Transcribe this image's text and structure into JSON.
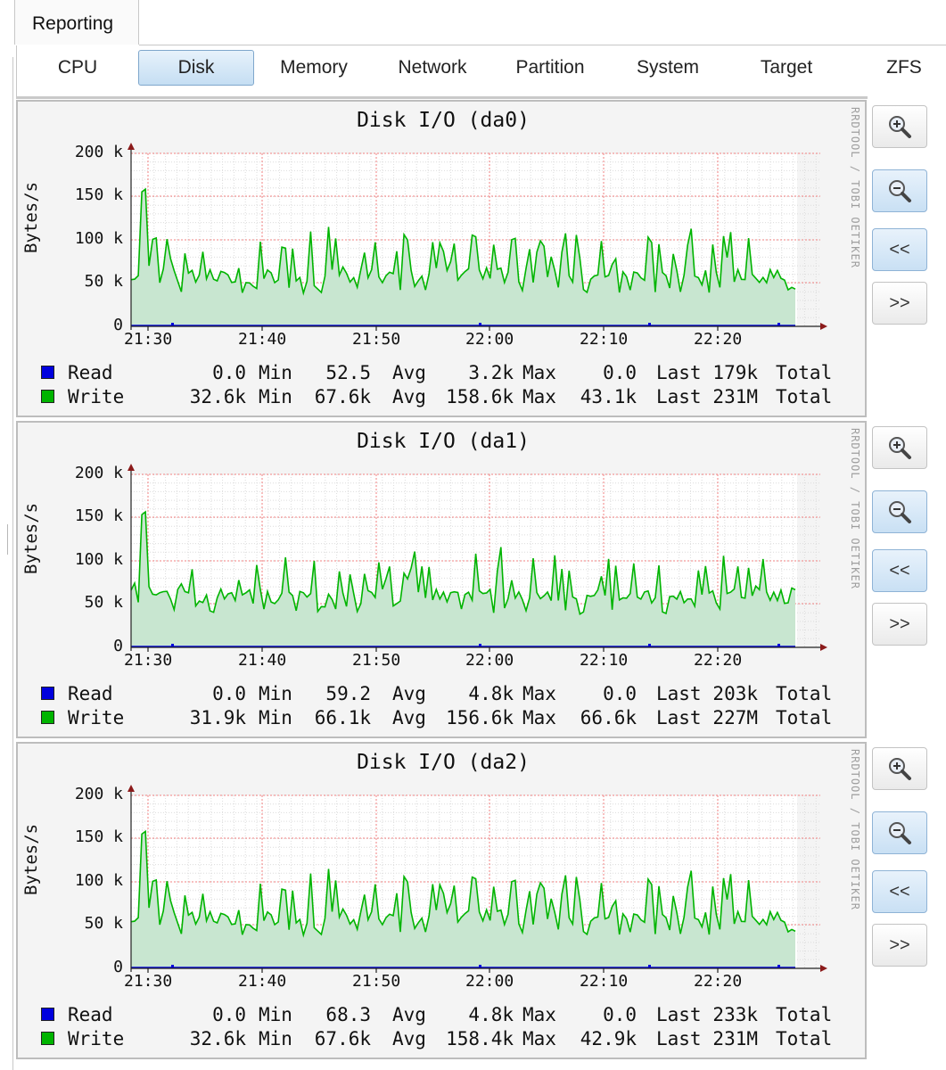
{
  "top_tab": "Reporting",
  "subtabs": [
    "CPU",
    "Disk",
    "Memory",
    "Network",
    "Partition",
    "System",
    "Target",
    "ZFS"
  ],
  "active_subtab": "Disk",
  "controls": {
    "zoom_in": "zoom-in-icon",
    "zoom_out": "zoom-out-icon",
    "back": "<<",
    "forward": ">>"
  },
  "watermark": "RRDTOOL / TOBI OETIKER",
  "colors": {
    "read": "#0000dd",
    "write": "#00b400",
    "write_fill": "#c8e6d0",
    "grid_major": "#f08080"
  },
  "graphs": [
    {
      "title": "Disk I/O (da0)",
      "ylabel": "Bytes/s",
      "yticks": [
        "200 k",
        "150 k",
        "100 k",
        "50 k",
        "0"
      ],
      "xticks": [
        "21:30",
        "21:40",
        "21:50",
        "22:00",
        "22:10",
        "22:20"
      ],
      "legend": [
        {
          "name": "Read",
          "min": "0.0",
          "avg": "52.5",
          "max": "3.2k",
          "last": "0.0",
          "total": "179k"
        },
        {
          "name": "Write",
          "min": "32.6k",
          "avg": "67.6k",
          "max": "158.6k",
          "last": "43.1k",
          "total": "231M"
        }
      ],
      "chart_data": {
        "type": "area",
        "ylim": [
          0,
          200000
        ],
        "series": [
          {
            "name": "Read"
          },
          {
            "name": "Write",
            "max": 158600,
            "avg": 67600,
            "last": 43100
          }
        ],
        "seed": 3
      }
    },
    {
      "title": "Disk I/O (da1)",
      "ylabel": "Bytes/s",
      "yticks": [
        "200 k",
        "150 k",
        "100 k",
        "50 k",
        "0"
      ],
      "xticks": [
        "21:30",
        "21:40",
        "21:50",
        "22:00",
        "22:10",
        "22:20"
      ],
      "legend": [
        {
          "name": "Read",
          "min": "0.0",
          "avg": "59.2",
          "max": "4.8k",
          "last": "0.0",
          "total": "203k"
        },
        {
          "name": "Write",
          "min": "31.9k",
          "avg": "66.1k",
          "max": "156.6k",
          "last": "66.6k",
          "total": "227M"
        }
      ],
      "chart_data": {
        "type": "area",
        "ylim": [
          0,
          200000
        ],
        "series": [
          {
            "name": "Read"
          },
          {
            "name": "Write",
            "max": 156600,
            "avg": 66100,
            "last": 66600
          }
        ],
        "seed": 5
      }
    },
    {
      "title": "Disk I/O (da2)",
      "ylabel": "Bytes/s",
      "yticks": [
        "200 k",
        "150 k",
        "100 k",
        "50 k",
        "0"
      ],
      "xticks": [
        "21:30",
        "21:40",
        "21:50",
        "22:00",
        "22:10",
        "22:20"
      ],
      "legend": [
        {
          "name": "Read",
          "min": "0.0",
          "avg": "68.3",
          "max": "4.8k",
          "last": "0.0",
          "total": "233k"
        },
        {
          "name": "Write",
          "min": "32.6k",
          "avg": "67.6k",
          "max": "158.4k",
          "last": "42.9k",
          "total": "231M"
        }
      ],
      "chart_data": {
        "type": "area",
        "ylim": [
          0,
          200000
        ],
        "series": [
          {
            "name": "Read"
          },
          {
            "name": "Write",
            "max": 158400,
            "avg": 67600,
            "last": 42900
          }
        ],
        "seed": 3
      }
    }
  ],
  "legend_labels": {
    "min": "Min",
    "avg": "Avg",
    "max": "Max",
    "last": "Last",
    "total": "Total"
  }
}
